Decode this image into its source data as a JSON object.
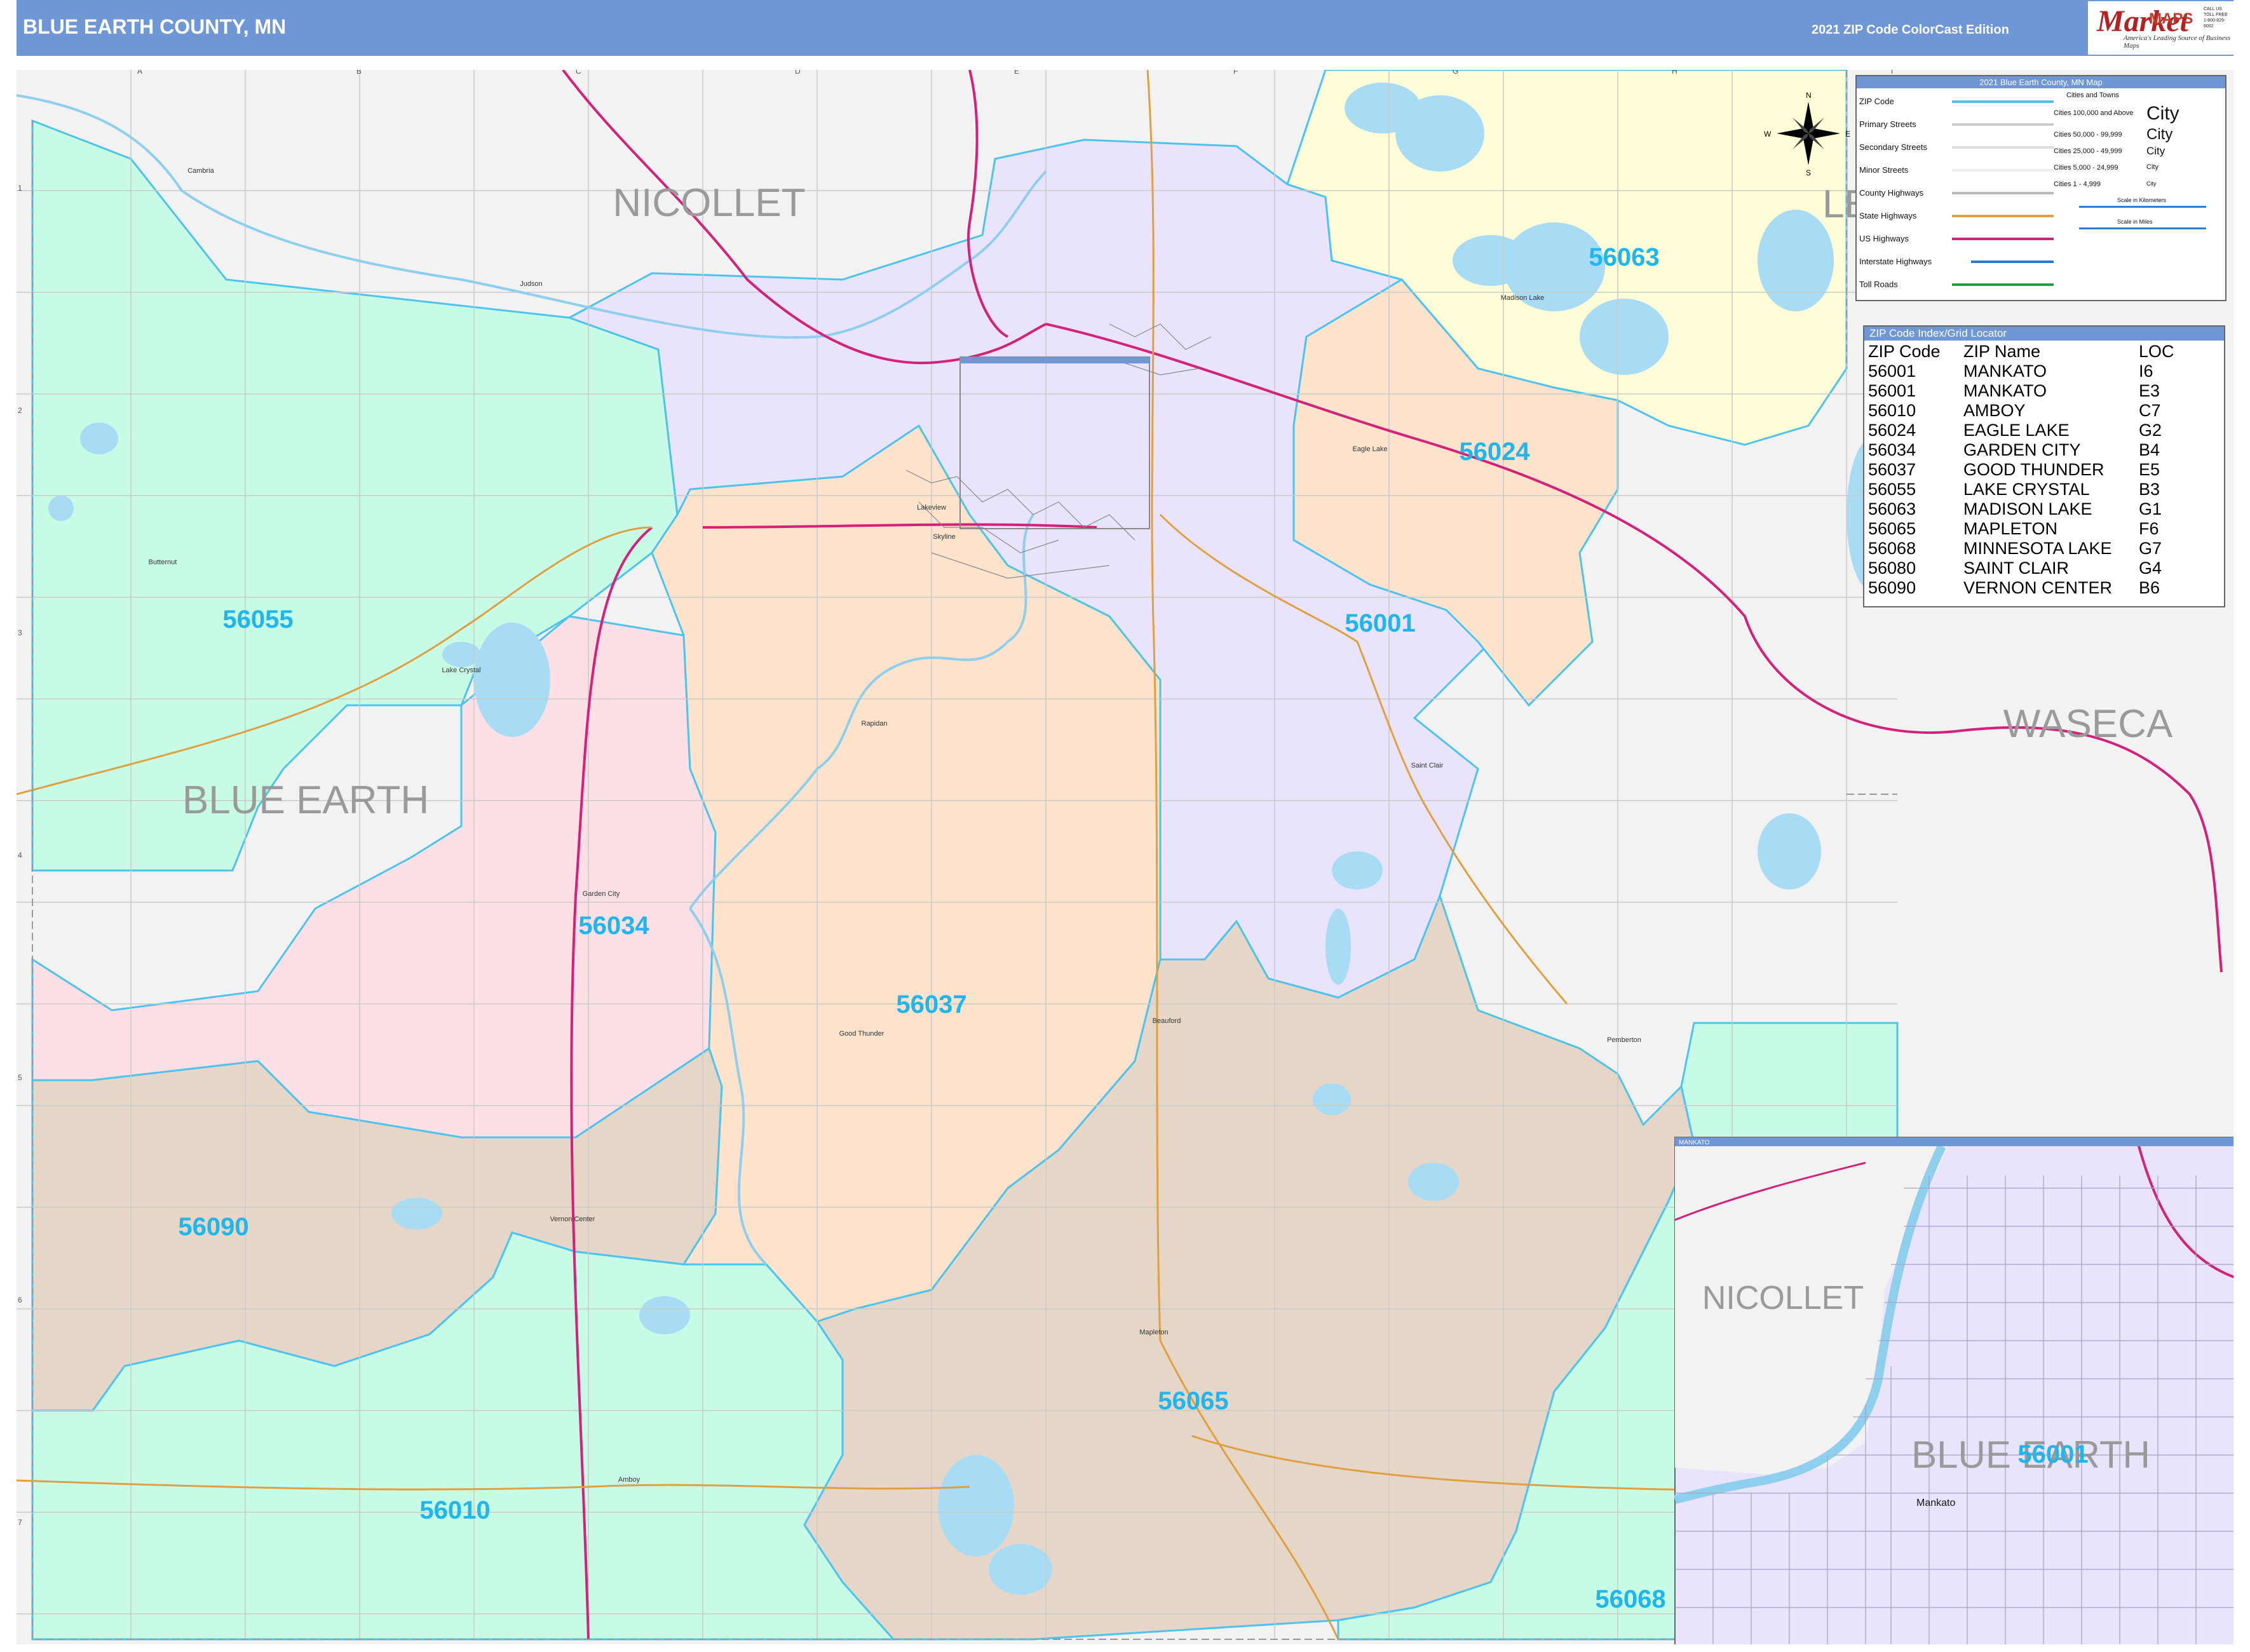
{
  "header": {
    "title": "BLUE EARTH COUNTY, MN",
    "edition": "2021 ZIP Code ColorCast Edition",
    "logo_text": "Market",
    "logo_maps": "MAPS",
    "logo_tagline": "America's Leading Source of Business Maps",
    "logo_contact": "CALL US TOLL FREE 1-800-829-6002"
  },
  "colors": {
    "header_blue": "#6f97d6",
    "zip_label": "#1fb6ee",
    "zip_border": "#4cc4ee",
    "us_highway": "#d4217a",
    "state_highway": "#e0a040",
    "water": "#a8dcf5",
    "purple": "#e9e4fc",
    "green": "#c8fbe6",
    "peach": "#fde3cc",
    "tan": "#e6d6c8",
    "pink": "#fde0e6",
    "yellow": "#fffcd8",
    "outside": "#f2f2f2"
  },
  "map": {
    "county_labels": [
      "NICOLLET",
      "LE",
      "WASECA",
      "BLUE EARTH"
    ],
    "zip_labels": [
      "56063",
      "56024",
      "56001",
      "56055",
      "56034",
      "56037",
      "56090",
      "56065",
      "56010",
      "56068"
    ],
    "compass": [
      "N",
      "S",
      "E",
      "W"
    ],
    "grid_columns": [
      "A",
      "B",
      "C",
      "D",
      "E",
      "F",
      "G",
      "H",
      "I"
    ],
    "grid_rows": [
      "1",
      "2",
      "3",
      "4",
      "5",
      "6",
      "7"
    ],
    "towns": [
      "Lake Crystal",
      "Garden City",
      "Vernon Center",
      "Amboy",
      "Mapleton",
      "Good Thunder",
      "Beauford",
      "Madison Lake",
      "Eagle Lake",
      "Saint Clair",
      "Pemberton",
      "Rapidan",
      "Skyline",
      "Judson",
      "Cambria",
      "Butternut",
      "Lakeview"
    ]
  },
  "legend": {
    "title": "2021 Blue Earth County, MN Map",
    "line_items": [
      {
        "label": "ZIP Code",
        "color": "#4cc4ee"
      },
      {
        "label": "Primary Streets",
        "color": "#cccccc"
      },
      {
        "label": "Secondary Streets",
        "color": "#dddddd"
      },
      {
        "label": "Minor Streets",
        "color": "#eeeeee"
      },
      {
        "label": "County Highways",
        "color": "#bbbbbb"
      },
      {
        "label": "State Highways",
        "color": "#e0a040"
      },
      {
        "label": "US Highways",
        "color": "#d4217a"
      },
      {
        "label": "Interstate Highways",
        "color": "#2a7bd4"
      },
      {
        "label": "Toll Roads",
        "color": "#20a040"
      }
    ],
    "cities_title": "Cities and Towns",
    "city_sizes": [
      {
        "range": "Cities 100,000 and Above",
        "sample": "City"
      },
      {
        "range": "Cities 50,000 - 99,999",
        "sample": "City"
      },
      {
        "range": "Cities 25,000 - 49,999",
        "sample": "City"
      },
      {
        "range": "Cities 5,000 - 24,999",
        "sample": "City"
      },
      {
        "range": "Cities 1 - 4,999",
        "sample": "City"
      }
    ],
    "scale_km": "Scale in Kilometers",
    "scale_mi": "Scale in Miles"
  },
  "zip_index": {
    "title": "ZIP Code Index/Grid Locator",
    "headers": [
      "ZIP Code",
      "ZIP Name",
      "LOC"
    ],
    "rows": [
      [
        "56001",
        "MANKATO",
        "I6"
      ],
      [
        "56001",
        "MANKATO",
        "E3"
      ],
      [
        "56010",
        "AMBOY",
        "C7"
      ],
      [
        "56024",
        "EAGLE LAKE",
        "G2"
      ],
      [
        "56034",
        "GARDEN CITY",
        "B4"
      ],
      [
        "56037",
        "GOOD THUNDER",
        "E5"
      ],
      [
        "56055",
        "LAKE CRYSTAL",
        "B3"
      ],
      [
        "56063",
        "MADISON LAKE",
        "G1"
      ],
      [
        "56065",
        "MAPLETON",
        "F6"
      ],
      [
        "56068",
        "MINNESOTA LAKE",
        "G7"
      ],
      [
        "56080",
        "SAINT CLAIR",
        "G4"
      ],
      [
        "56090",
        "VERNON CENTER",
        "B6"
      ]
    ]
  },
  "inset": {
    "title": "MANKATO",
    "labels": [
      "NICOLLET",
      "BLUE EARTH",
      "56001",
      "Mankato"
    ]
  }
}
